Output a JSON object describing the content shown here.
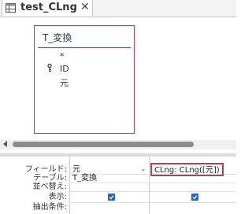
{
  "tab": {
    "title": "test_CLng",
    "close": "✕"
  },
  "table": {
    "name": "T_変換",
    "fields": [
      "*",
      "ID",
      "元"
    ]
  },
  "grid": {
    "row_labels": [
      "フィールド:",
      "テーブル:",
      "並べ替え:",
      "表示:",
      "抽出条件:"
    ],
    "columns": [
      {
        "field": "元",
        "table": "T_変換",
        "show": true
      },
      {
        "field": "CLng: CLng([元])",
        "table": "",
        "show": true
      }
    ]
  },
  "colors": {
    "accent": "#b0415a",
    "checkbox": "#1e63c7",
    "scroll_thumb": "#8c8c8c"
  }
}
